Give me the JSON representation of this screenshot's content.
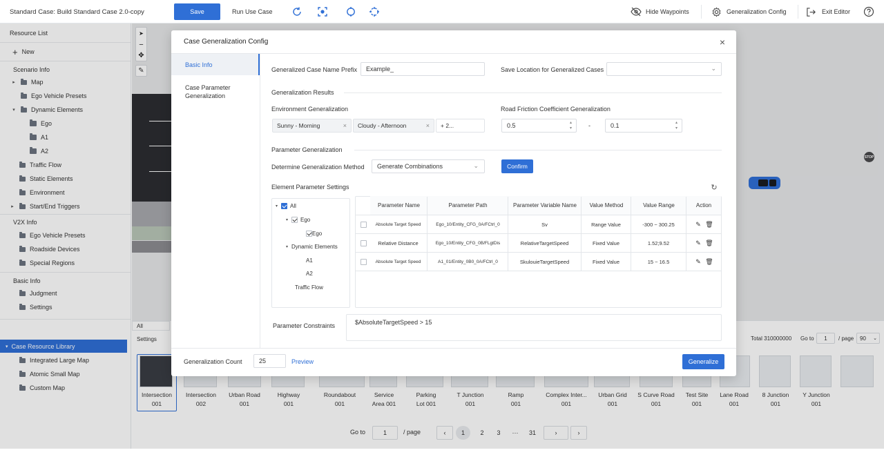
{
  "topbar": {
    "case_title": "Standard Case: Build Standard Case 2.0-copy",
    "save_label": "Save",
    "run_label": "Run Use Case",
    "hide_waypoints_label": "Hide Waypoints",
    "generalization_config_label": "Generalization Config",
    "exit_editor_label": "Exit Editor",
    "icons": [
      "rotate-icon",
      "focus-icon",
      "cycle-icon",
      "dashed-cycle-icon",
      "eye-off-icon",
      "gear-icon",
      "exit-icon",
      "help-icon"
    ]
  },
  "sidebar": {
    "resource_list": "Resource List",
    "new_label": "New",
    "scenario_info": "Scenario Info",
    "scenario_items": [
      "Map",
      "Ego Vehicle Presets",
      "Dynamic Elements",
      "Ego",
      "A1",
      "A2",
      "Traffic Flow",
      "Static Elements",
      "Environment",
      "Start/End Triggers"
    ],
    "v2x_info": "V2X Info",
    "v2x_items": [
      "Ego Vehicle Presets",
      "Roadside Devices",
      "Special Regions"
    ],
    "basic_info": "Basic Info",
    "basic_items": [
      "Judgment",
      "Settings"
    ],
    "library": "Case Resource Library",
    "library_items": [
      "Integrated Large Map",
      "Atomic Small Map",
      "Custom Map"
    ]
  },
  "library_bar": {
    "filter_all": "All",
    "settings_tab": "Settings",
    "total": "Total 310000000",
    "goto_label": "Go to",
    "goto_value": "1",
    "per_page_label": "/ page",
    "per_page_value": "90",
    "thumbnails": [
      {
        "line1": "Intersection",
        "line2": "001"
      },
      {
        "line1": "Intersection",
        "line2": "002"
      },
      {
        "line1": "Urban Road",
        "line2": "001"
      },
      {
        "line1": "Highway",
        "line2": "001"
      },
      {
        "line1": "Roundabout",
        "line2": "001"
      },
      {
        "line1": "Service",
        "line2": "Area 001"
      },
      {
        "line1": "Parking",
        "line2": "Lot 001"
      },
      {
        "line1": "T Junction",
        "line2": "001"
      },
      {
        "line1": "Ramp",
        "line2": "001"
      },
      {
        "line1": "Complex Inter...",
        "line2": "001"
      },
      {
        "line1": "Urban Grid",
        "line2": "001"
      },
      {
        "line1": "S Curve Road",
        "line2": "001"
      },
      {
        "line1": "Test Site",
        "line2": "001"
      },
      {
        "line1": "Lane Road",
        "line2": "001"
      },
      {
        "line1": "8 Junction",
        "line2": "001"
      },
      {
        "line1": "Y Junction",
        "line2": "001"
      }
    ],
    "pager": {
      "goto_label": "Go to",
      "goto_value": "1",
      "per_page": "/ page",
      "pages": [
        "1",
        "2",
        "3",
        "···",
        "31"
      ]
    }
  },
  "canvas": {
    "stop_sign": "STOP"
  },
  "modal": {
    "title": "Case Generalization Config",
    "nav": [
      "Basic Info",
      "Case Parameter Generalization"
    ],
    "name_prefix_label": "Generalized Case Name Prefix",
    "name_prefix_value": "Example_",
    "save_location_label": "Save Location for Generalized Cases",
    "save_location_value": "",
    "results_title": "Generalization Results",
    "env_label": "Environment Generalization",
    "env_chips": [
      "Sunny - Morning",
      "Cloudy - Afternoon"
    ],
    "env_more": "+ 2...",
    "friction_label": "Road Friction Coefficient Generalization",
    "friction_min": "0.5",
    "friction_dash": "-",
    "friction_max": "0.1",
    "param_title": "Parameter Generalization",
    "method_label": "Determine Generalization Method",
    "method_value": "Generate Combinations",
    "confirm_label": "Confirm",
    "element_settings_label": "Element Parameter Settings",
    "tree": {
      "all": "All",
      "ego_group": "Ego",
      "ego": "Ego",
      "dynamic": "Dynamic Elements",
      "a1": "A1",
      "a2": "A2",
      "traffic_flow": "Traffic Flow"
    },
    "table": {
      "headers": [
        "Parameter Name",
        "Parameter Path",
        "Parameter Variable Name",
        "Value Method",
        "Value Range",
        "Action"
      ],
      "rows": [
        {
          "name": "Absolute Target Speed",
          "path": "Ego_10/Entity_CFG_0A/FCtrl_0",
          "var": "Sv",
          "method": "Range Value",
          "range": "-300 ~ 300.25"
        },
        {
          "name": "Relative Distance",
          "path": "Ego_10/Entity_CFG_0B/FLgtDis",
          "var": "RelativeTargetSpeed",
          "method": "Fixed Value",
          "range": "1.52;9.52"
        },
        {
          "name": "Absolute Target Speed",
          "path": "A1_01/Entity_0B0_0A/FCtrl_0",
          "var": "SkulouieTargetSpeed",
          "method": "Fixed Value",
          "range": "15 ~ 16.5"
        }
      ]
    },
    "constraints_label": "Parameter Constraints",
    "constraints_value": "$AbsoluteTargetSpeed > 15",
    "count_label": "Generalization Count",
    "count_value": "25",
    "preview_label": "Preview",
    "generalize_label": "Generalize"
  },
  "colors": {
    "accent": "#2f6fd6",
    "selected_bg": "#2f6fd6",
    "panel_border": "#e3e6ea"
  }
}
